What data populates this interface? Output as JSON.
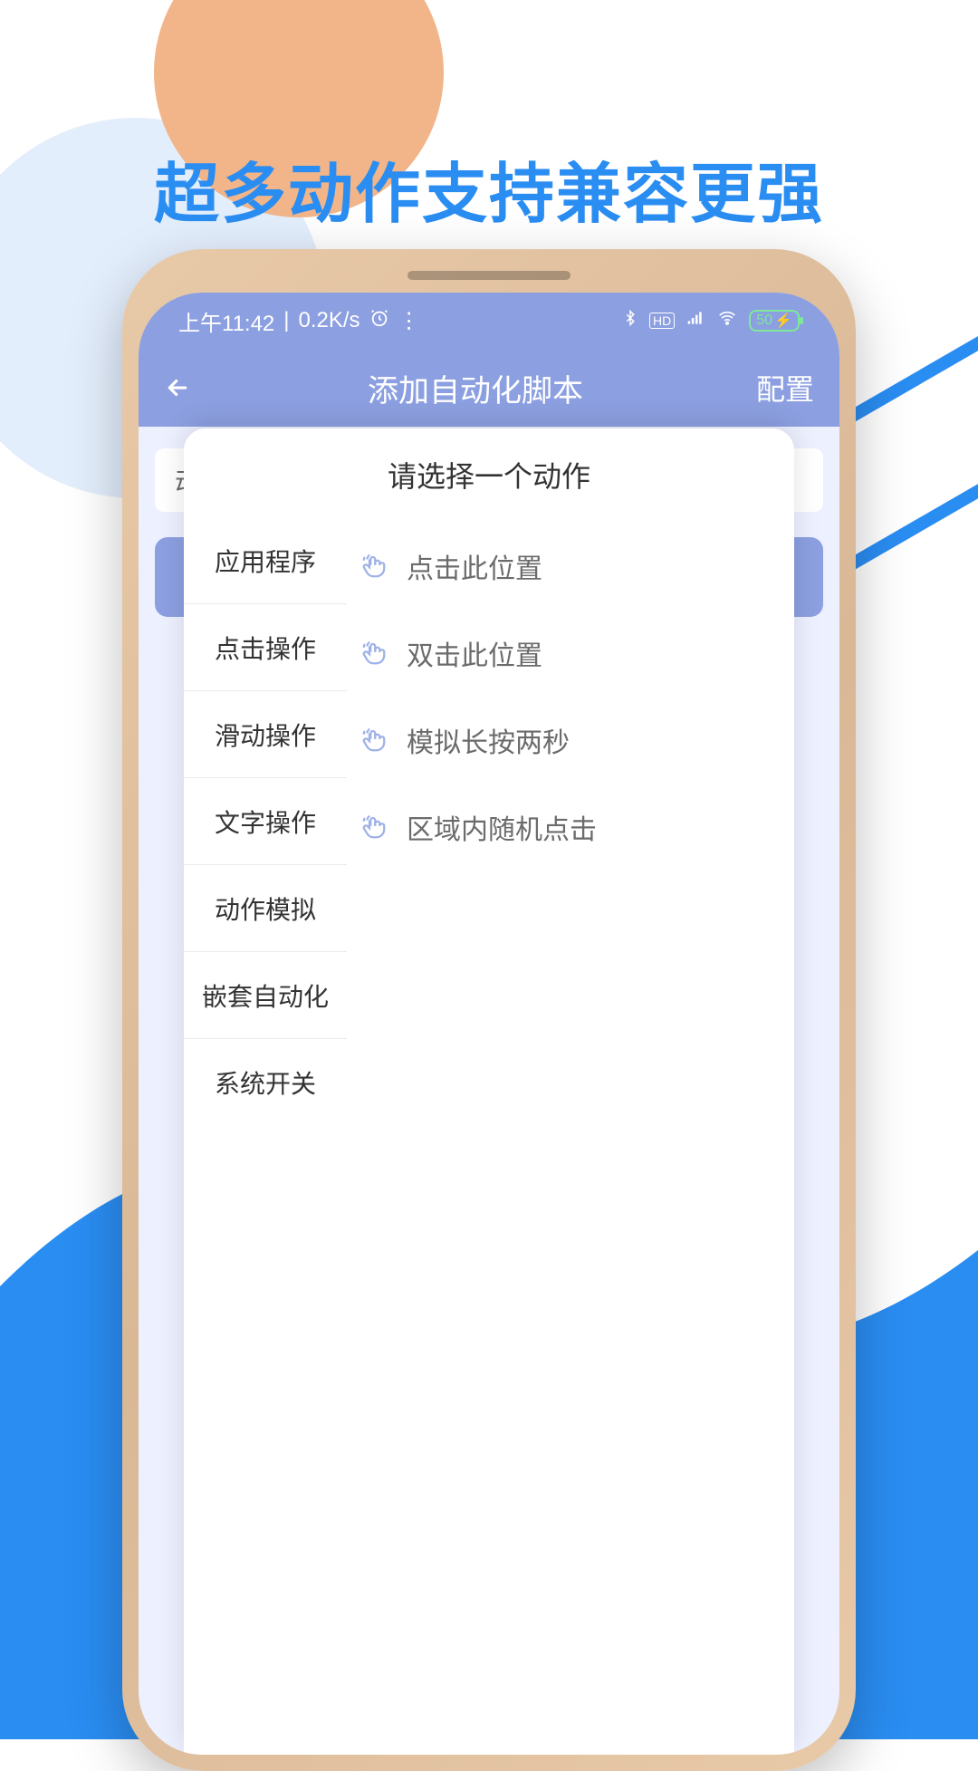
{
  "headline": "超多动作支持兼容更强",
  "status": {
    "time": "上午11:42",
    "net_speed": "0.2K/s",
    "battery": "50"
  },
  "header": {
    "title": "添加自动化脚本",
    "action": "配置"
  },
  "input_prefix": "动作",
  "modal": {
    "title": "请选择一个动作",
    "categories": [
      "应用程序",
      "点击操作",
      "滑动操作",
      "文字操作",
      "动作模拟",
      "嵌套自动化",
      "系统开关"
    ],
    "options": [
      "点击此位置",
      "双击此位置",
      "模拟长按两秒",
      "区域内随机点击"
    ]
  }
}
